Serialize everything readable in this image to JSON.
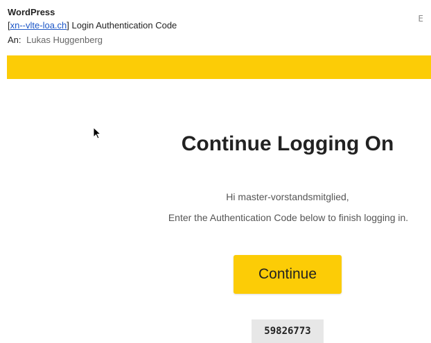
{
  "email": {
    "sender": "WordPress",
    "subject_link": "xn--vlte-loa.ch",
    "subject_open_bracket": "[",
    "subject_close_bracket": "]",
    "subject_rest": " Login Authentication Code",
    "to_label": "An:",
    "to_value": "Lukas Huggenberg",
    "overflow_glyph": "E"
  },
  "body": {
    "banner_color": "#fccc06",
    "title": "Continue Logging On",
    "greeting": "Hi master-vorstandsmitglied,",
    "instructions": "Enter the Authentication Code below to finish logging in.",
    "continue_label": "Continue",
    "auth_code": "59826773"
  }
}
